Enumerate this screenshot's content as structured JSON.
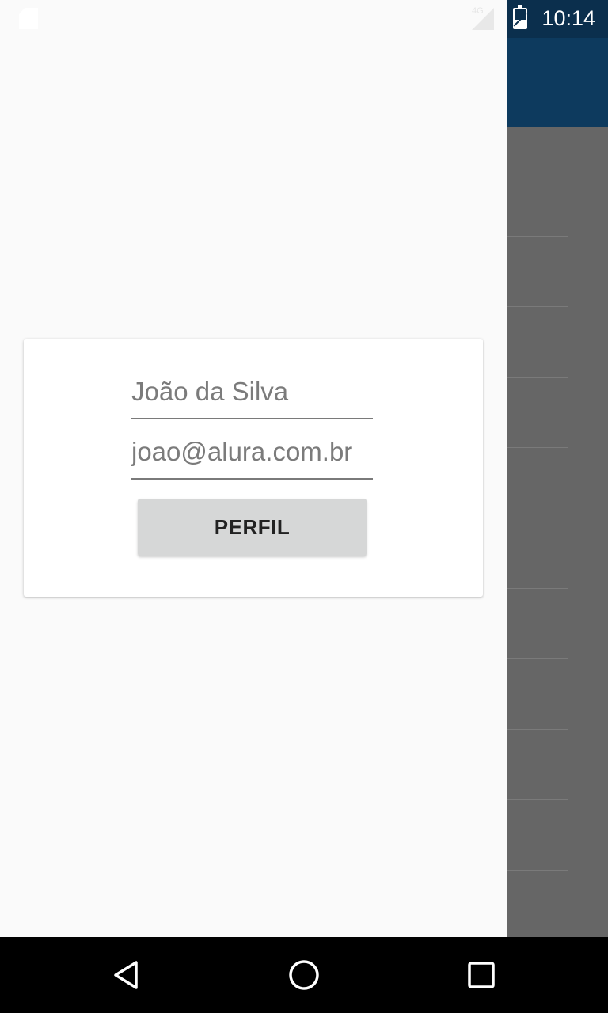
{
  "status_bar": {
    "time": "10:14",
    "network_label": "4G",
    "icons": [
      "sd-card-icon",
      "signal-icon",
      "battery-icon"
    ]
  },
  "drawer": {
    "profile_card": {
      "name": "João da Silva",
      "email": "joao@alura.com.br",
      "profile_button_label": "PERFIL"
    }
  },
  "navigation_bar": {
    "buttons": [
      "back-icon",
      "home-icon",
      "recents-icon"
    ]
  },
  "colors": {
    "toolbar": "#0d3a5e",
    "scrim": "#666666",
    "drawer_background": "#fafafa",
    "button_background": "#d6d7d7"
  }
}
